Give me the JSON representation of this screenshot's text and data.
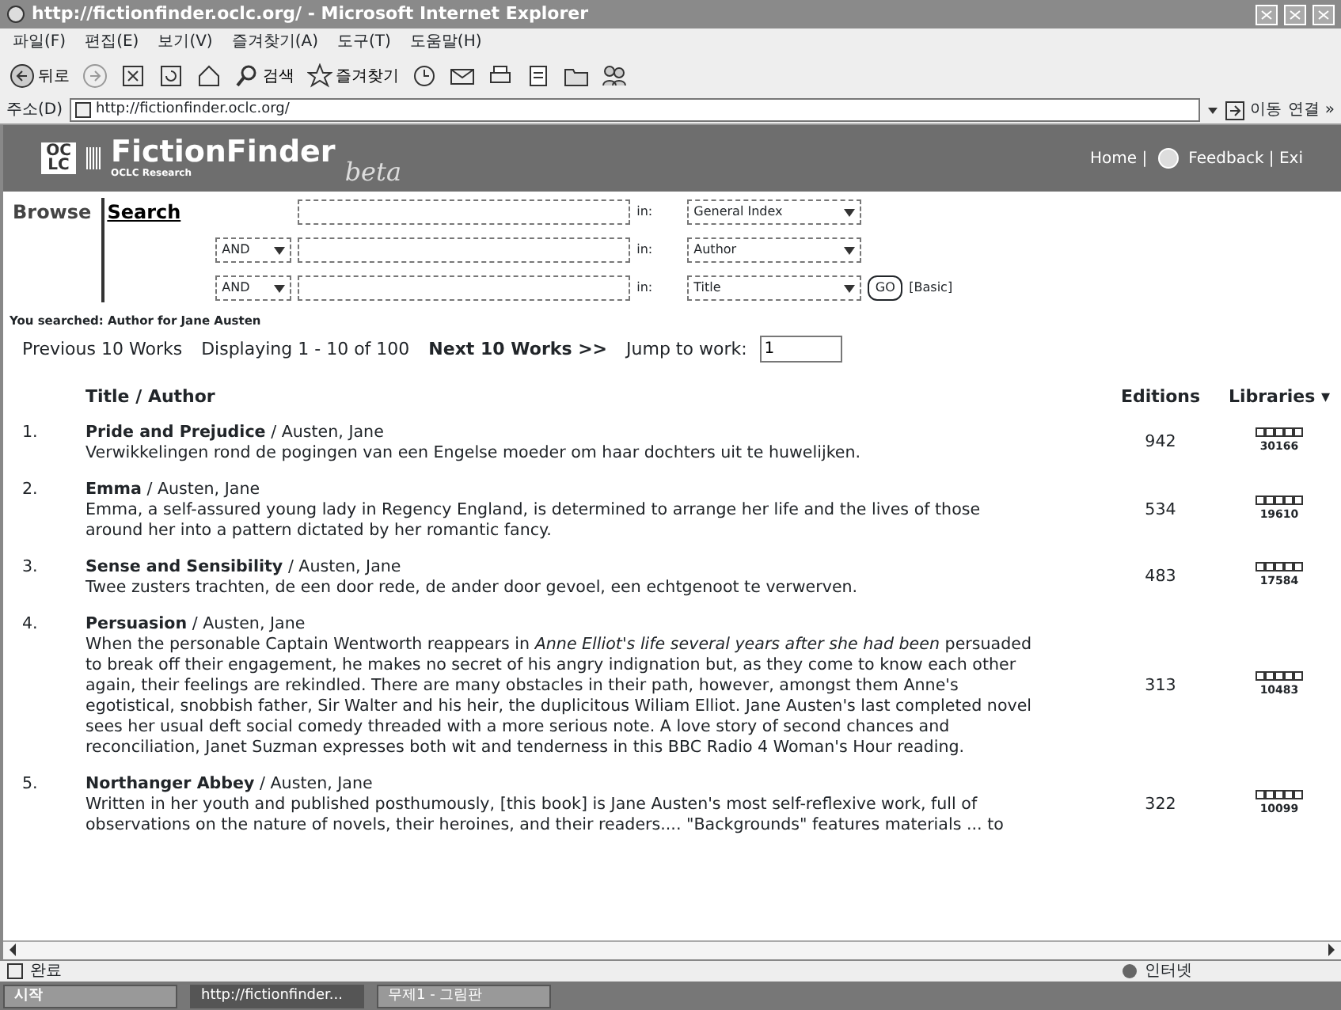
{
  "window": {
    "title": "http://fictionfinder.oclc.org/ - Microsoft Internet Explorer"
  },
  "menu": [
    "파일(F)",
    "편집(E)",
    "보기(V)",
    "즐겨찾기(A)",
    "도구(T)",
    "도움말(H)"
  ],
  "toolbar": [
    {
      "kind": "back",
      "label": "뒤로"
    },
    {
      "kind": "forward"
    },
    {
      "kind": "stop"
    },
    {
      "kind": "refresh"
    },
    {
      "kind": "home"
    },
    {
      "kind": "search",
      "label": "검색"
    },
    {
      "kind": "favorites",
      "label": "즐겨찾기"
    },
    {
      "kind": "history"
    },
    {
      "kind": "mail"
    },
    {
      "kind": "print"
    },
    {
      "kind": "edit"
    },
    {
      "kind": "folder"
    },
    {
      "kind": "messenger"
    }
  ],
  "address": {
    "label": "주소(D)",
    "url": "http://fictionfinder.oclc.org/",
    "go": "이동",
    "links": "연결 »"
  },
  "banner": {
    "logo": "OC LC",
    "title": "FictionFinder",
    "subtitle": "OCLC Research",
    "beta": "beta",
    "links": [
      "Home |",
      "Feedback | Exi"
    ]
  },
  "search": {
    "tabs": [
      {
        "label": "Browse",
        "selected": false
      },
      {
        "label": "Search",
        "selected": true
      }
    ],
    "rows": [
      {
        "index": "General Index",
        "in_label": "in:"
      },
      {
        "operator": "AND",
        "index": "Author",
        "in_label": "in:"
      },
      {
        "operator": "AND",
        "index": "Title",
        "in_label": "in:"
      }
    ],
    "go": "GO",
    "basic": "[Basic]"
  },
  "you_searched": "You searched: Author for **Jane Austen**",
  "pager": {
    "previous": "Previous 10 Works",
    "displaying": "Displaying 1 - 10 of 100",
    "next": "Next 10 Works >>",
    "jump_label": "Jump to work:",
    "jump_value": "1"
  },
  "table": {
    "columns": [
      "Title / Author",
      "Editions",
      "Libraries ▾"
    ],
    "rows": [
      {
        "number": "1.",
        "title": "Pride and Prejudice",
        "author": "/ Austen, Jane",
        "description": "Verwikkelingen rond de pogingen van een Engelse moeder om haar dochters uit te huwelijken.",
        "editions": "942",
        "libraries": "30166"
      },
      {
        "number": "2.",
        "title": "Emma",
        "author": "/ Austen, Jane",
        "description": "Emma, a self-assured young lady in Regency England, is determined to arrange her life and the lives of those around her into a pattern dictated by her romantic fancy.",
        "editions": "534",
        "libraries": "19610"
      },
      {
        "number": "3.",
        "title": "Sense and Sensibility",
        "author": "/ Austen, Jane",
        "description": "Twee zusters trachten, de een door rede, de ander door gevoel, een echtgenoot te verwerven.",
        "editions": "483",
        "libraries": "17584"
      },
      {
        "number": "4.",
        "title": "Persuasion",
        "author": "/ Austen, Jane",
        "description": "When the personable Captain Wentworth reappears in *Anne Elliot's life several years after she had been* persuaded to break off their engagement, he makes no secret of his angry indignation but, as they come to know each other again, their feelings are rekindled. There are many obstacles in their path, however, amongst them Anne's egotistical, snobbish father, Sir Walter and his heir, the duplicitous Wiliam Elliot. Jane Austen's last completed novel sees her usual deft social comedy threaded with a more serious note. A love story of second chances and reconciliation, Janet Suzman expresses both wit and tenderness in this BBC Radio 4 Woman's Hour reading.",
        "editions": "313",
        "libraries": "10483"
      },
      {
        "number": "5.",
        "title": "Northanger Abbey",
        "author": "/ Austen, Jane",
        "description": "Written in her youth and published posthumously, [this book] is Jane Austen's most self-reflexive work, full of observations on the nature of novels, their heroines, and their readers.... \"Backgrounds\" features materials ... to",
        "editions": "322",
        "libraries": "10099"
      }
    ]
  },
  "status": {
    "text": "완료",
    "zone": "인터넷"
  },
  "taskbar": {
    "start": "시작",
    "tasks": [
      {
        "label": "http://fictionfinder...",
        "selected": true
      },
      {
        "label": "무제1 - 그림판",
        "selected": false
      }
    ]
  }
}
